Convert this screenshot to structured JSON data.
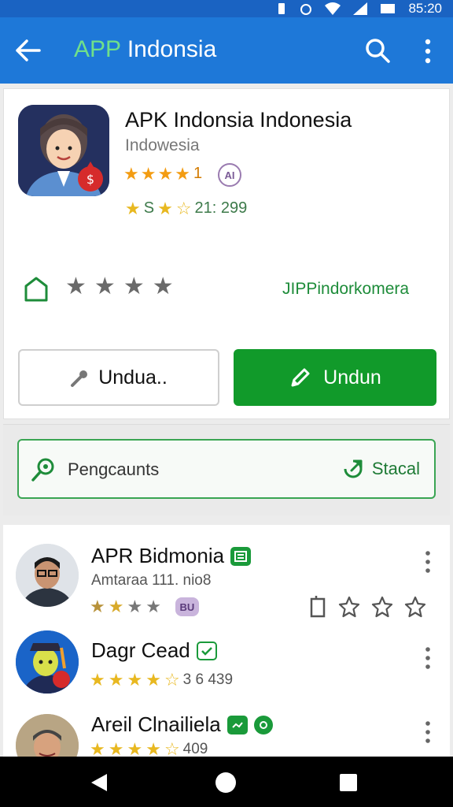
{
  "status_bar": {
    "time": "85:20"
  },
  "app_bar": {
    "title_prefix": "APP",
    "title_rest": " Indonsia",
    "back_icon": "arrow-left-icon",
    "search_icon": "search-icon",
    "more_icon": "more-vertical-icon"
  },
  "app": {
    "name": "APK Indonsia Indonesia",
    "subtitle": "Indowesia",
    "rating_value": "1",
    "rating_stars": 4,
    "badge": "AI",
    "rating2_label": "S",
    "rating2_value": "21: 299",
    "developer": "JIPPindorkomera",
    "secondary_button": "Undua..",
    "primary_button": "Undun"
  },
  "info": {
    "left_label": "Pengcaunts",
    "right_label": "Stacal"
  },
  "list": [
    {
      "title": "APR Bidmonia",
      "subtitle": "Amtaraa 111. nio8",
      "chip": "BU"
    },
    {
      "title": "Dagr Cead",
      "rating_value": "3 6 439"
    },
    {
      "title": "Areil Clnailiela",
      "rating_value": "409"
    }
  ],
  "colors": {
    "app_bar": "#1e78d8",
    "primary": "#119a2a",
    "accent_text": "#1e8c3a"
  }
}
